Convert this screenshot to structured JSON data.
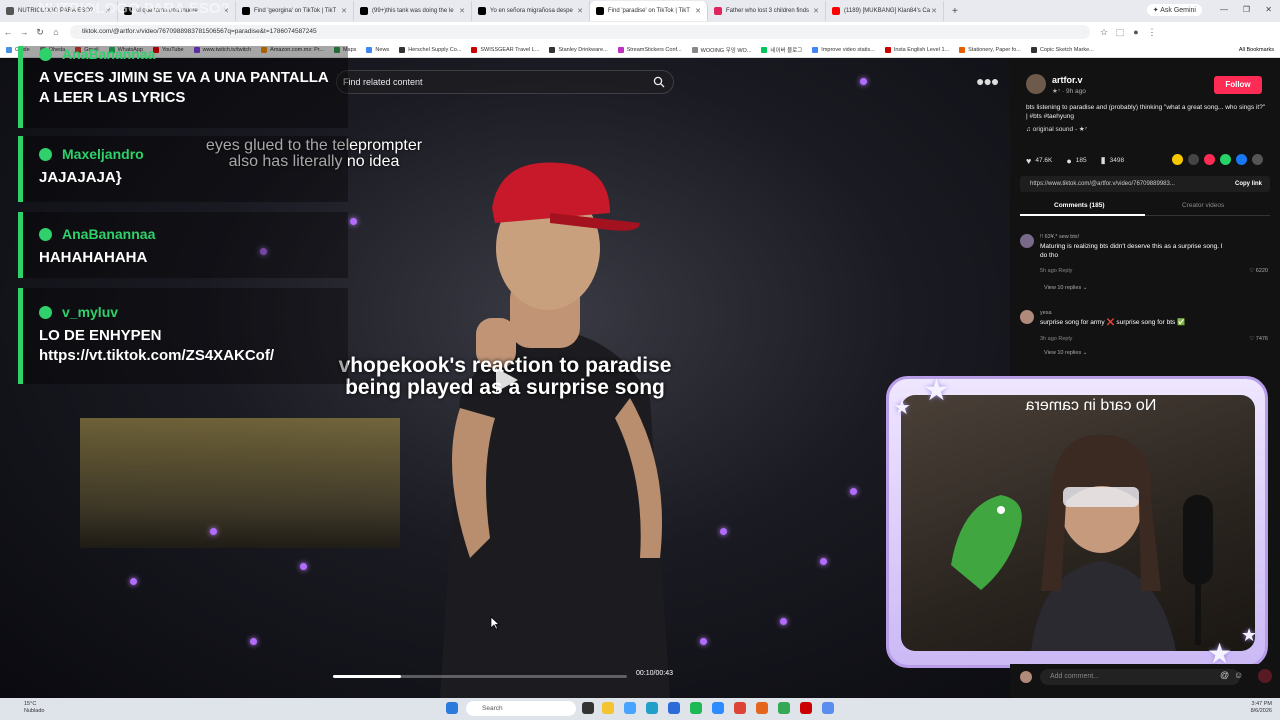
{
  "browser": {
    "tabs": [
      {
        "label": "NUTRIOLOGO PARA ESO?",
        "color": "#555"
      },
      {
        "label": "el que toma una muere",
        "color": "#000"
      },
      {
        "label": "Find 'georgina' on TikTok | TikT",
        "color": "#000"
      },
      {
        "label": "(99+)this tank was doing the le",
        "color": "#000"
      },
      {
        "label": "Yo en señora migrañosa despe",
        "color": "#000"
      },
      {
        "label": "Find 'paradise' on TikTok | TikT",
        "color": "#000"
      },
      {
        "label": "Father who lost 3 children finds",
        "color": "#e0245e"
      },
      {
        "label": "(1189) [MUKBANG] Klan84's Ca",
        "color": "#ff0000"
      }
    ],
    "ask_gemini": "Ask Gemini",
    "url": "tiktok.com/@artfor.v/video/7670988983781506567q=paradise&t=1786074587245",
    "bookmarks": [
      "Guide",
      "Oheda",
      "Gmail",
      "WhatsApp",
      "YouTube",
      "www.twitch.tv/twitch",
      "Amazon.com.mx: Pr...",
      "Maps",
      "News",
      "Herschel Supply Co...",
      "SWISSGEAR Travel L...",
      "Stanley Drinkware...",
      "StreamStickers Conf...",
      "WOOING 우잉 WO...",
      "네이버 블로그",
      "Improve video statis...",
      "Insta English Level 1...",
      "Stationery, Paper fo...",
      "Copic Sketch Marke..."
    ],
    "all_bookmarks": "All Bookmarks"
  },
  "video": {
    "search_placeholder": "Find related content",
    "caption_top": "eyes glued to the teleprompter also has literally no idea",
    "caption_main": "vhopekook's reaction to paradise being played as a surprise song",
    "time": "00:10/00:43",
    "progress": 0.23
  },
  "chat": {
    "top_faded": "NUTRIOLOGO PARA ESO?",
    "messages": [
      {
        "user": "AnaBanannaa",
        "text": "A VECES JIMIN SE VA A UNA PANTALLA A LEER LAS LYRICS"
      },
      {
        "user": "Maxeljandro",
        "text": "JAJAJAJA}"
      },
      {
        "user": "AnaBanannaa",
        "text": "HAHAHAHAHA"
      },
      {
        "user": "v_myluv",
        "text": "LO DE ENHYPEN https://vt.tiktok.com/ZS4XAKCof/"
      }
    ]
  },
  "panel": {
    "author": "artfor.v",
    "author_sub": "★⁷ · 9h ago",
    "follow": "Follow",
    "description": "bts listening to paradise and (probably) thinking \"what a great song... who sings it?\" | #bts #taehyung",
    "sound": "♫ original sound - ★⁷",
    "likes": "47.6K",
    "comments_count": "185",
    "saves": "3498",
    "link": "https://www.tiktok.com/@artfor.v/video/76709889983...",
    "copy_link": "Copy link",
    "tab_comments": "Comments (185)",
    "tab_creator": "Creator videos",
    "comments": [
      {
        "user": "!! 63¥,* sew bts!",
        "text": "Maturing is realizing bts didn't deserve this as a surprise song. I do tho",
        "meta": "5h ago   Reply",
        "likes": "♡ 6220",
        "replies": "View 10 replies ⌄"
      },
      {
        "user": "yesa",
        "text": "surprise song for army ❌ surprise song for bts ✅",
        "meta": "3h ago   Reply",
        "likes": "♡ 7476",
        "replies": "View 10 replies ⌄"
      }
    ],
    "add_comment": "Add comment..."
  },
  "webcam": {
    "mirror_text": "No card in camera"
  },
  "taskbar": {
    "weather_temp": "15°C",
    "weather_desc": "Nublado",
    "search": "Search",
    "time": "3:47 PM",
    "date": "8/6/2026"
  },
  "colors": {
    "chat_green": "#2fd16a",
    "follow_red": "#fe2c55",
    "light_purple": "#b46cff"
  }
}
